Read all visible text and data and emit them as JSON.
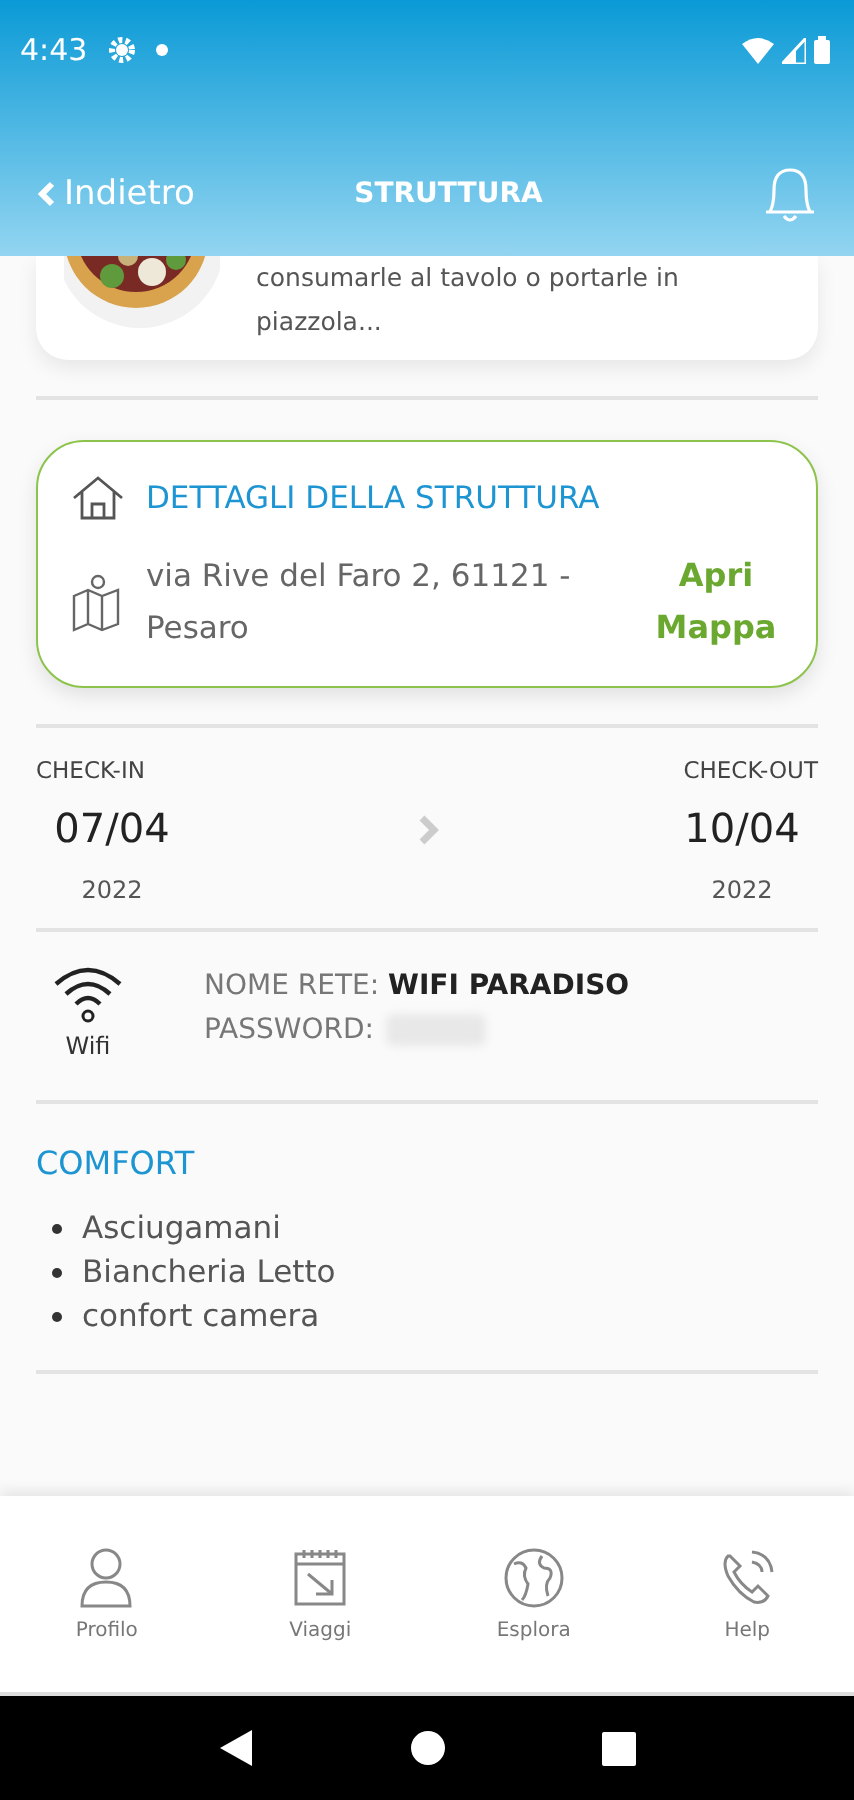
{
  "status_bar": {
    "time": "4:43"
  },
  "header": {
    "back": "Indietro",
    "title": "STRUTTURA"
  },
  "teaser": {
    "lines": [
      "consumarle al tavolo o portarle in",
      "piazzola..."
    ]
  },
  "details": {
    "title": "DETTAGLI DELLA STRUTTURA",
    "address": "via Rive del Faro 2, 61121 - Pesaro",
    "map_link": "Apri Mappa"
  },
  "stay": {
    "checkin_label": "CHECK-IN",
    "checkin_date": "07/04",
    "checkin_year": "2022",
    "checkout_label": "CHECK-OUT",
    "checkout_date": "10/04",
    "checkout_year": "2022"
  },
  "wifi": {
    "label": "Wifi",
    "network_label": "NOME RETE:",
    "network": "WIFI PARADISO",
    "password_label": "PASSWORD:",
    "password_hidden": true
  },
  "comfort": {
    "title": "COMFORT",
    "items": [
      "Asciugamani",
      "Biancheria Letto",
      "confort camera"
    ]
  },
  "tabs": [
    {
      "label": "Profilo",
      "selected": false
    },
    {
      "label": "Viaggi",
      "selected": false
    },
    {
      "label": "Esplora",
      "selected": false
    },
    {
      "label": "Help",
      "selected": false
    }
  ]
}
